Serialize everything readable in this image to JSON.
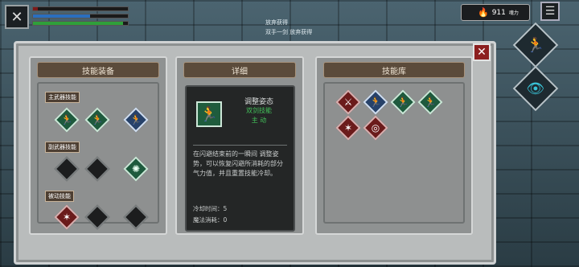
{
  "hud": {
    "power_value": "911",
    "power_unit": "魂力",
    "bars": {
      "hp": 5,
      "mp": 60,
      "stamina": 95
    }
  },
  "chat": {
    "line1": "放弃获得",
    "line2": "双手一剑 放弃获得"
  },
  "icons": {
    "character": "crossed-swords-icon",
    "menu": "list-icon",
    "power": "flame-icon",
    "dash": "running-figure-icon",
    "view": "eye-icon",
    "close": "close-icon"
  },
  "panels": {
    "equip": {
      "title": "技能装备",
      "main_weapon_label": "主武器技能",
      "sub_weapon_label": "副武器技能",
      "passive_label": "被动技能"
    },
    "detail": {
      "title": "详细",
      "skill_name": "调整姿态",
      "skill_category": "双剑技能",
      "skill_type": "主 动",
      "description": "在闪避结束前的一瞬间 调整姿势，可以恢复闪避所消耗的部分气力值，并且重置技能冷却。",
      "cooldown": "冷却时间：5",
      "mana_cost": "魔法消耗：0"
    },
    "library": {
      "title": "技能库"
    }
  }
}
